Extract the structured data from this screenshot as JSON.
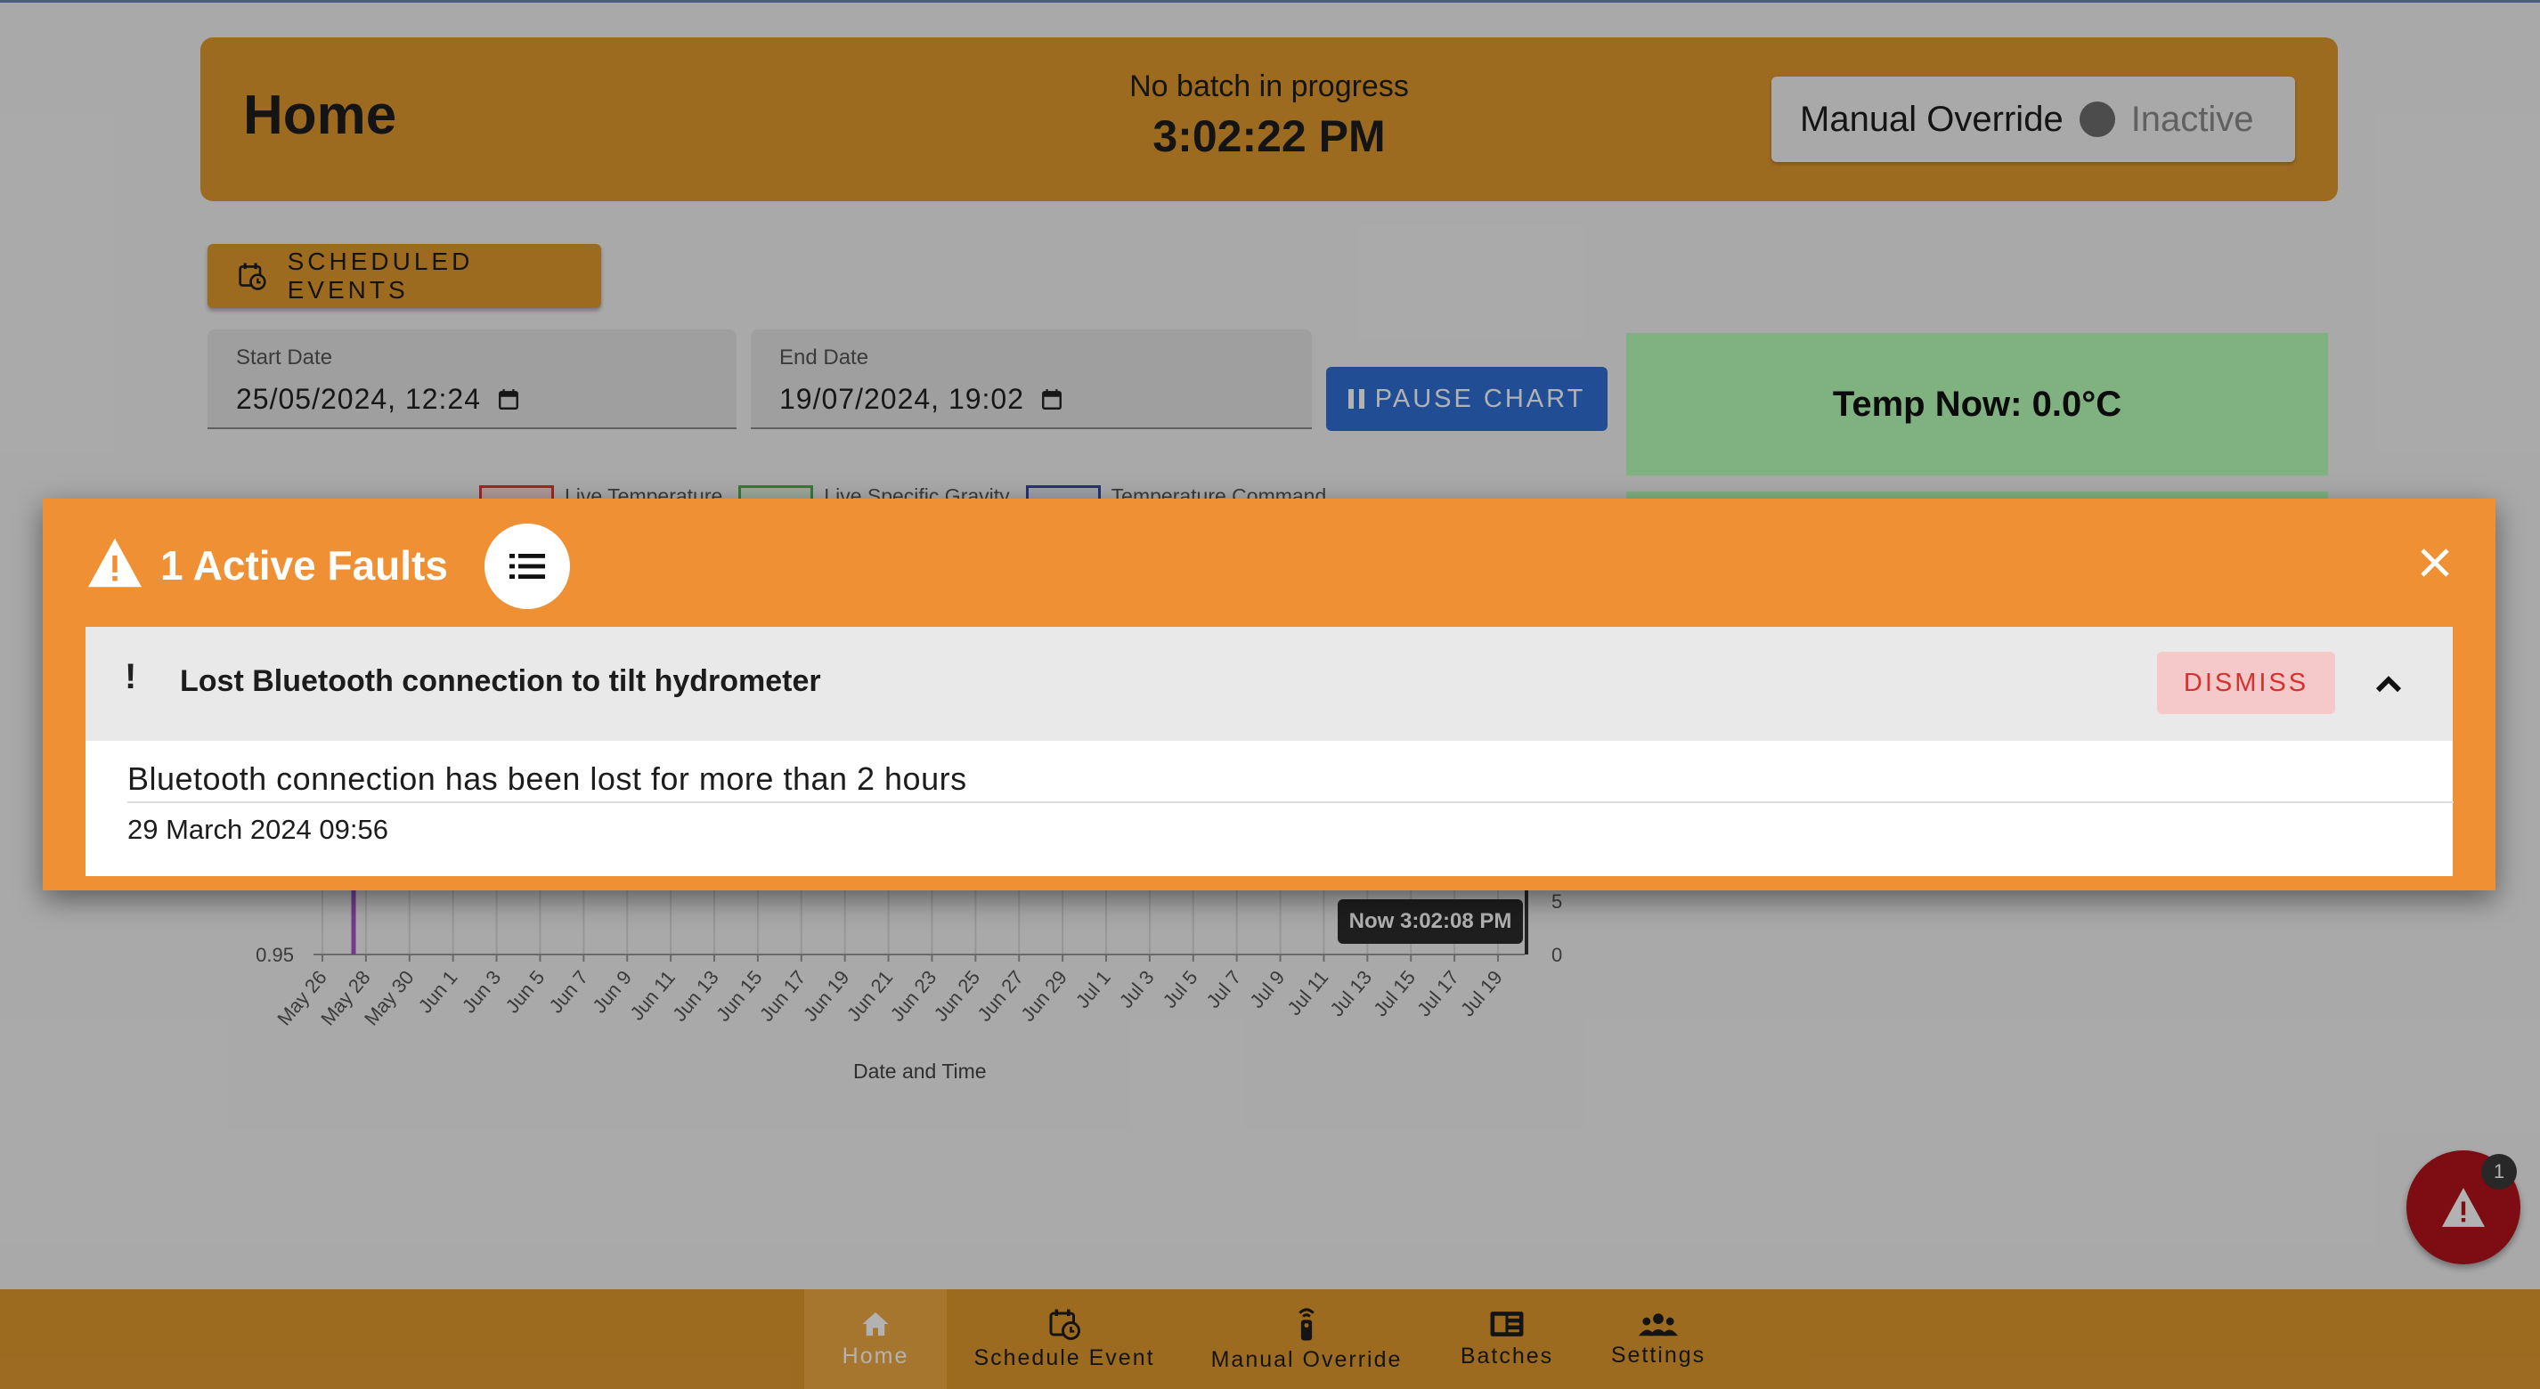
{
  "header": {
    "title": "Home",
    "batch_status": "No batch in progress",
    "clock": "3:02:22 PM",
    "override_label": "Manual Override",
    "override_state": "Inactive"
  },
  "toolbar": {
    "scheduled_events_label": "SCHEDULED EVENTS",
    "start_date_label": "Start Date",
    "start_date_value": "25/05/2024, 12:24",
    "end_date_label": "End Date",
    "end_date_value": "19/07/2024, 19:02",
    "pause_chart_label": "PAUSE CHART"
  },
  "status_cards": {
    "temp_now": "Temp Now: 0.0°C"
  },
  "chart": {
    "legend": [
      "Live Temperature",
      "Live Specific Gravity",
      "Temperature Command"
    ],
    "legend_colors": [
      "#e53935",
      "#4caf50",
      "#3949ab"
    ],
    "left_axis_tick": "0.95",
    "right_axis_ticks": [
      "5",
      "0"
    ],
    "x_ticks": [
      "May 26",
      "May 28",
      "May 30",
      "Jun 1",
      "Jun 3",
      "Jun 5",
      "Jun 7",
      "Jun 9",
      "Jun 11",
      "Jun 13",
      "Jun 15",
      "Jun 17",
      "Jun 19",
      "Jun 21",
      "Jun 23",
      "Jun 25",
      "Jun 27",
      "Jun 29",
      "Jul 1",
      "Jul 3",
      "Jul 5",
      "Jul 7",
      "Jul 9",
      "Jul 11",
      "Jul 13",
      "Jul 15",
      "Jul 17",
      "Jul 19"
    ],
    "now_label": "Now 3:02:08 PM",
    "x_axis_title": "Date and Time"
  },
  "fault_dialog": {
    "title": "1 Active Faults",
    "fault_name": "Lost Bluetooth connection to tilt hydrometer",
    "dismiss_label": "DISMISS",
    "description": "Bluetooth connection has been lost for more than 2 hours",
    "timestamp": "29 March 2024 09:56",
    "excl": "!"
  },
  "fab": {
    "badge_count": "1"
  },
  "nav": {
    "items": [
      {
        "label": "Home",
        "icon": "home-icon"
      },
      {
        "label": "Schedule Event",
        "icon": "calendar-clock-icon"
      },
      {
        "label": "Manual Override",
        "icon": "remote-icon"
      },
      {
        "label": "Batches",
        "icon": "book-icon"
      },
      {
        "label": "Settings",
        "icon": "people-icon"
      }
    ]
  },
  "colors": {
    "accent": "#e19a2f",
    "fault_banner": "#ee9033",
    "primary_button": "#2f6fd3",
    "temp_card": "#b6ffb8",
    "danger": "#b3141a"
  }
}
